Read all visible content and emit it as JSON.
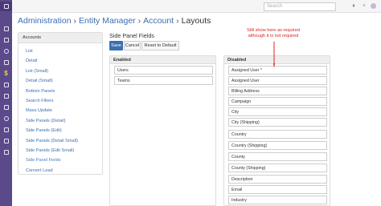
{
  "sidebar": {
    "icons": [
      "menu-icon",
      "dashboard-icon",
      "accounts-icon",
      "contacts-icon",
      "leads-icon",
      "opportunities-icon",
      "cases-icon",
      "email-icon",
      "calendar-icon",
      "meetings-icon",
      "calls-icon",
      "tasks-icon",
      "documents-icon"
    ]
  },
  "topbar": {
    "search_placeholder": "Search"
  },
  "breadcrumb": {
    "items": [
      "Administration",
      "Entity Manager",
      "Account",
      "Layouts"
    ],
    "separator": "›"
  },
  "left_panel": {
    "heading": "Accounts",
    "items": [
      "List",
      "Detail",
      "List (Small)",
      "Detail (Small)",
      "Bottom Panels",
      "Search Filters",
      "Mass Update",
      "Side Panels (Detail)",
      "Side Panels (Edit)",
      "Side Panels (Detail Small)",
      "Side Panels (Edit Small)",
      "Side Panel Fields",
      "Convert Lead"
    ],
    "active_index": 11
  },
  "main": {
    "title": "Side Panel Fields",
    "buttons": {
      "save": "Save",
      "cancel": "Cancel",
      "reset": "Reset to Default"
    },
    "enabled": {
      "heading": "Enabled",
      "fields": [
        "Users",
        "Teams"
      ]
    },
    "disabled": {
      "heading": "Disabled",
      "fields": [
        "Assigned User *",
        "Assigned User",
        "Billing Address",
        "Campaign",
        "City",
        "City (Shipping)",
        "Country",
        "Country (Shipping)",
        "County",
        "County (Shipping)",
        "Description",
        "Email",
        "Industry"
      ]
    }
  },
  "annotation": {
    "text_line1": "Still show here as required",
    "text_line2": "although it is not required",
    "color": "#dd2222"
  },
  "colors": {
    "sidebar": "#5a4a8a",
    "link": "#3a6fb0",
    "save_button": "#3a6fb0"
  }
}
